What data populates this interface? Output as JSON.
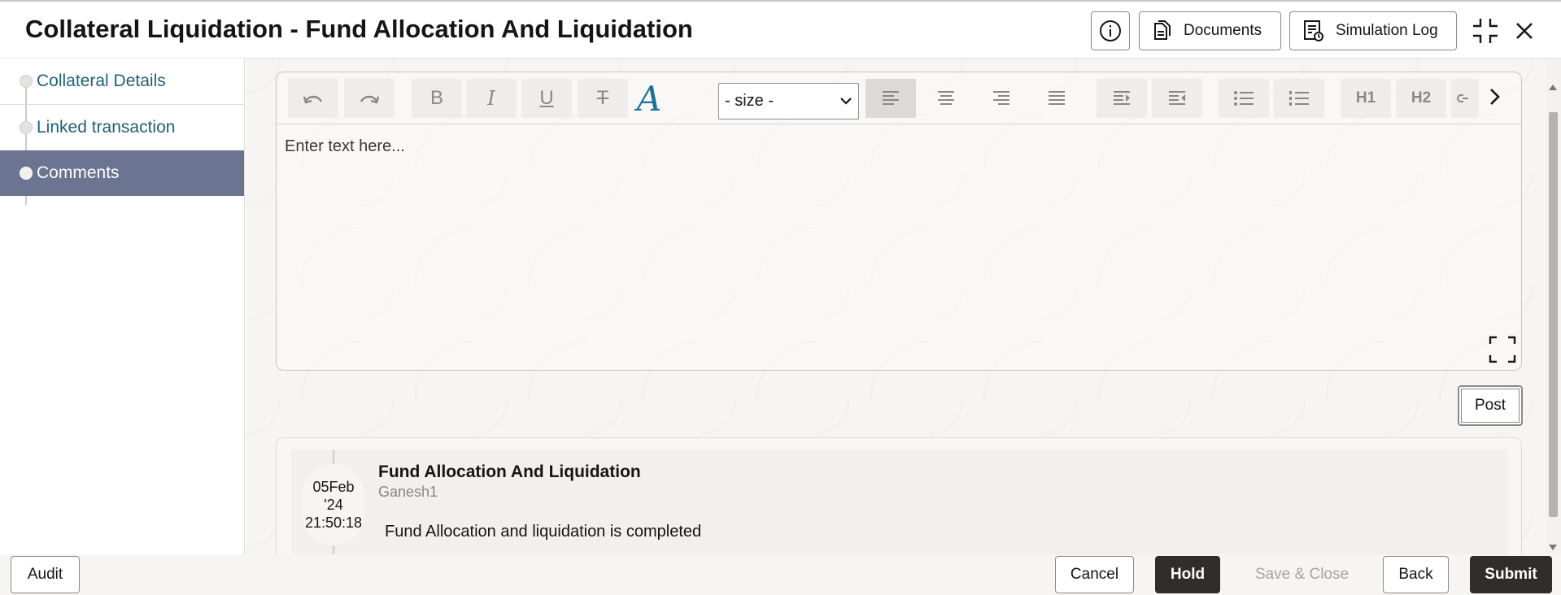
{
  "header": {
    "title": "Collateral Liquidation - Fund Allocation And Liquidation",
    "info_icon": "info-icon",
    "documents_label": "Documents",
    "simulation_log_label": "Simulation Log",
    "collapse_icon": "collapse-icon",
    "close_icon": "close-icon"
  },
  "sidebar": {
    "items": [
      {
        "label": "Collateral Details",
        "active": false
      },
      {
        "label": "Linked transaction",
        "active": false
      },
      {
        "label": "Comments",
        "active": true
      }
    ]
  },
  "editor": {
    "toolbar": {
      "undo_icon": "undo-icon",
      "redo_icon": "redo-icon",
      "bold_label": "B",
      "italic_label": "I",
      "underline_label": "U",
      "strikethrough_label": "T",
      "font_color_label": "A",
      "size_select_value": "- size -",
      "heading1_label": "H1",
      "heading2_label": "H2",
      "more_icon": "chevron-right-icon"
    },
    "placeholder": "Enter text here...",
    "post_label": "Post"
  },
  "comments": [
    {
      "date_day": "05Feb",
      "date_year": "'24",
      "time": "21:50:18",
      "title": "Fund Allocation And Liquidation",
      "user": "Ganesh1",
      "text": "Fund Allocation and liquidation is completed"
    }
  ],
  "footer": {
    "audit_label": "Audit",
    "cancel_label": "Cancel",
    "hold_label": "Hold",
    "save_close_label": "Save & Close",
    "back_label": "Back",
    "submit_label": "Submit"
  },
  "colors": {
    "sidebar_active_bg": "#6b7591",
    "link_text": "#1f5f7a",
    "primary_dark_button": "#312d2a"
  }
}
